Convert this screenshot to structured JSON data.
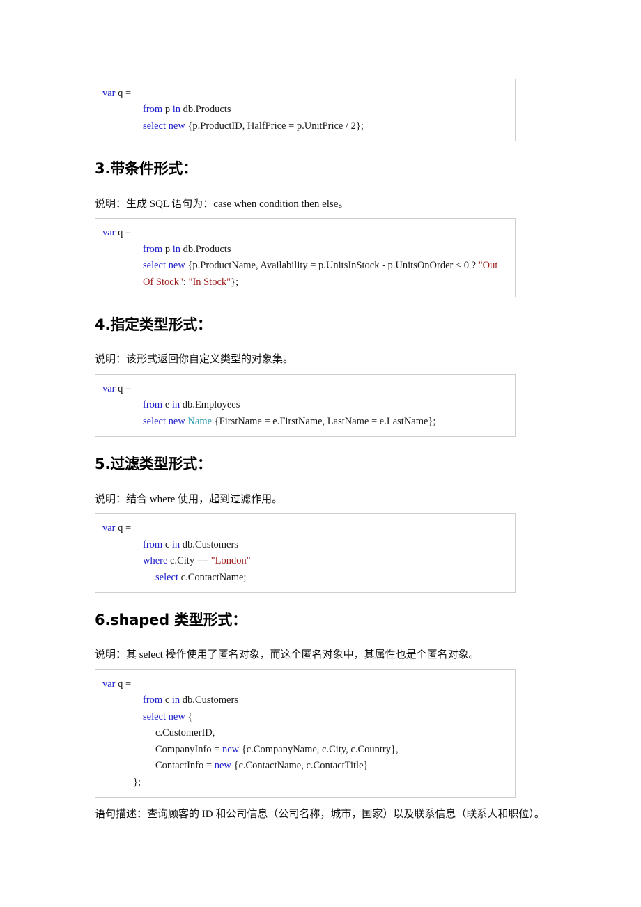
{
  "document": {
    "sections": [
      {
        "id": "section-2-continued",
        "heading": null,
        "description": null,
        "code": {
          "lines": [
            [
              {
                "t": "var",
                "c": "kw"
              },
              {
                "t": " q =",
                "c": "plain"
              }
            ],
            [
              {
                "t": "from",
                "c": "kw"
              },
              {
                "t": " p ",
                "c": "plain"
              },
              {
                "t": "in",
                "c": "kw"
              },
              {
                "t": " db.Products",
                "c": "plain"
              }
            ],
            [
              {
                "t": "select new",
                "c": "kw"
              },
              {
                "t": " {p.ProductID, HalfPrice = p.UnitPrice / 2};",
                "c": "plain"
              }
            ]
          ]
        }
      },
      {
        "id": "section-3",
        "heading": "3.带条件形式：",
        "description": "说明：生成 SQL 语句为：case when condition then else。",
        "code": {
          "lines": [
            [
              {
                "t": "var",
                "c": "kw"
              },
              {
                "t": " q =",
                "c": "plain"
              }
            ],
            [
              {
                "t": "from",
                "c": "kw"
              },
              {
                "t": " p ",
                "c": "plain"
              },
              {
                "t": "in",
                "c": "kw"
              },
              {
                "t": " db.Products",
                "c": "plain"
              }
            ],
            [
              {
                "t": "select new",
                "c": "kw"
              },
              {
                "t": " {p.ProductName, Availability = p.UnitsInStock - p.UnitsOnOrder < 0 ? ",
                "c": "plain"
              },
              {
                "t": "\"Out Of Stock\"",
                "c": "str"
              },
              {
                "t": ": ",
                "c": "plain"
              },
              {
                "t": "\"In Stock\"",
                "c": "str"
              },
              {
                "t": "};",
                "c": "plain"
              }
            ]
          ]
        }
      },
      {
        "id": "section-4",
        "heading": "4.指定类型形式：",
        "description": "说明：该形式返回你自定义类型的对象集。",
        "code": {
          "lines": [
            [
              {
                "t": "var",
                "c": "kw"
              },
              {
                "t": " q =",
                "c": "plain"
              }
            ],
            [
              {
                "t": "from",
                "c": "kw"
              },
              {
                "t": " e ",
                "c": "plain"
              },
              {
                "t": "in",
                "c": "kw"
              },
              {
                "t": " db.Employees",
                "c": "plain"
              }
            ],
            [
              {
                "t": "select new",
                "c": "kw"
              },
              {
                "t": " ",
                "c": "plain"
              },
              {
                "t": "Name",
                "c": "type"
              },
              {
                "t": " {FirstName = e.FirstName, LastName = e.LastName};",
                "c": "plain"
              }
            ]
          ]
        }
      },
      {
        "id": "section-5",
        "heading": "5.过滤类型形式：",
        "description": "说明：结合 where 使用，起到过滤作用。",
        "code": {
          "lines": [
            [
              {
                "t": "var",
                "c": "kw"
              },
              {
                "t": " q =",
                "c": "plain"
              }
            ],
            [
              {
                "t": "from",
                "c": "kw"
              },
              {
                "t": " c ",
                "c": "plain"
              },
              {
                "t": "in",
                "c": "kw"
              },
              {
                "t": " db.Customers",
                "c": "plain"
              }
            ],
            [
              {
                "t": "where",
                "c": "kw"
              },
              {
                "t": " c.City == ",
                "c": "plain"
              },
              {
                "t": "\"London\"",
                "c": "str"
              }
            ],
            [
              {
                "t": "select",
                "c": "kw"
              },
              {
                "t": " c.ContactName;",
                "c": "plain"
              }
            ]
          ]
        }
      },
      {
        "id": "section-6",
        "heading": "6.shaped 类型形式：",
        "description": "说明：其 select 操作使用了匿名对象，而这个匿名对象中，其属性也是个匿名对象。",
        "code": {
          "lines": [
            [
              {
                "t": "var",
                "c": "kw"
              },
              {
                "t": " q =",
                "c": "plain"
              }
            ],
            [
              {
                "t": "from",
                "c": "kw"
              },
              {
                "t": " c ",
                "c": "plain"
              },
              {
                "t": "in",
                "c": "kw"
              },
              {
                "t": " db.Customers",
                "c": "plain"
              }
            ],
            [
              {
                "t": "select new",
                "c": "kw"
              },
              {
                "t": " {",
                "c": "plain"
              }
            ],
            [
              {
                "t": "c.CustomerID,",
                "c": "plain"
              }
            ],
            [
              {
                "t": "CompanyInfo = ",
                "c": "plain"
              },
              {
                "t": "new",
                "c": "kw"
              },
              {
                "t": " {c.CompanyName, c.City, c.Country},",
                "c": "plain"
              }
            ],
            [
              {
                "t": "ContactInfo = ",
                "c": "plain"
              },
              {
                "t": "new",
                "c": "kw"
              },
              {
                "t": " {c.ContactName, c.ContactTitle}",
                "c": "plain"
              }
            ],
            [
              {
                "t": "};",
                "c": "plain"
              }
            ]
          ]
        },
        "footnote": "语句描述：查询顾客的 ID 和公司信息（公司名称，城市，国家）以及联系信息（联系人和职位）。"
      }
    ]
  },
  "colors": {
    "keyword": "#2222cc",
    "type": "#2e9fb0",
    "string": "#9e1b1b",
    "text": "#1a1a1a",
    "box_border": "#cfcfcf",
    "page_background": "#ffffff"
  }
}
